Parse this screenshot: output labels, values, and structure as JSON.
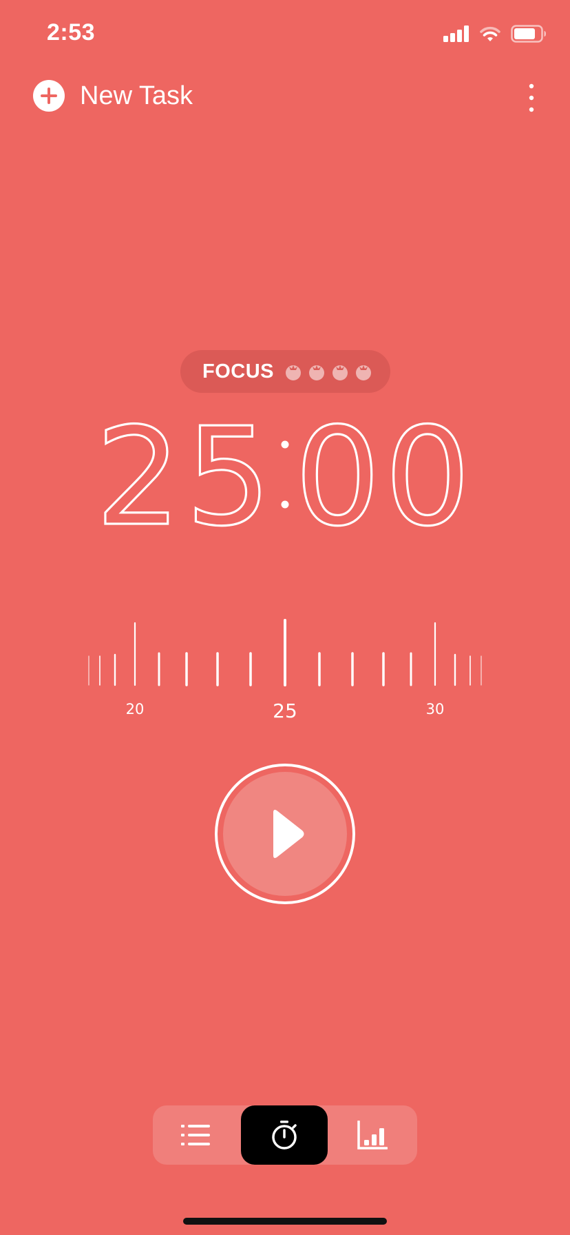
{
  "status_bar": {
    "time": "2:53",
    "signal_icon": "cellular-signal-icon",
    "wifi_icon": "wifi-icon",
    "battery_icon": "battery-icon"
  },
  "header": {
    "new_task_label": "New Task",
    "add_icon": "plus-circle-icon",
    "menu_icon": "more-vertical-icon"
  },
  "session": {
    "label": "FOCUS",
    "tomato_icon": "tomato-icon",
    "tomato_count": 4
  },
  "timer": {
    "minutes": "25",
    "seconds": "00"
  },
  "duration_ruler": {
    "labels": [
      "20",
      "25",
      "30"
    ],
    "selected_value": 25
  },
  "controls": {
    "play_icon": "play-icon"
  },
  "tabs": [
    {
      "name": "list",
      "icon": "list-icon",
      "active": false
    },
    {
      "name": "timer",
      "icon": "stopwatch-icon",
      "active": true
    },
    {
      "name": "stats",
      "icon": "bar-chart-icon",
      "active": false
    }
  ],
  "colors": {
    "background": "#EE6661",
    "pill": "#DB5A56",
    "tabbar": "#F07F7B",
    "active_tab": "#000000",
    "foreground": "#FFFFFF"
  }
}
